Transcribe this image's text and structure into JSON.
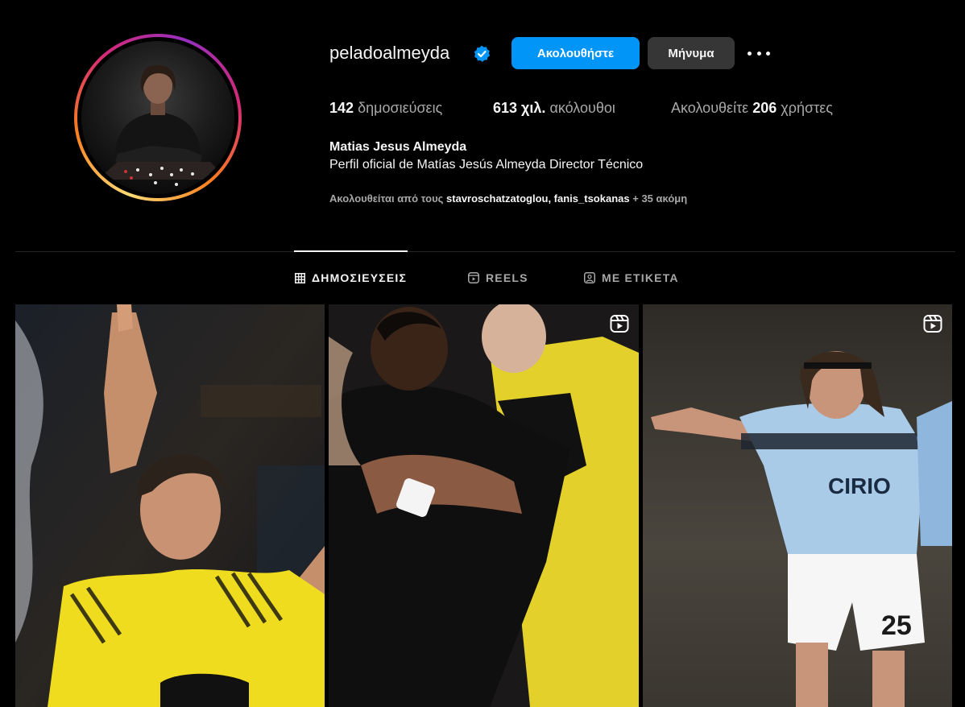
{
  "profile": {
    "username": "peladoalmeyda",
    "full_name": "Matias Jesus Almeyda",
    "bio": "Perfil oficial de Matías Jesús Almeyda Director Técnico",
    "verified_icon": "verified-badge-icon"
  },
  "actions": {
    "follow_label": "Ακολουθήστε",
    "message_label": "Μήνυμα",
    "more_icon": "more-options-icon"
  },
  "stats": {
    "posts_count": "142",
    "posts_label": "δημοσιεύσεις",
    "followers_count": "613 χιλ.",
    "followers_label": "ακόλουθοι",
    "following_prefix": "Ακολουθείτε",
    "following_count": "206",
    "following_suffix": "χρήστες"
  },
  "followed_by": {
    "prefix": "Ακολουθείται από τους",
    "accounts": "stavroschatzatoglou, fanis_tsokanas",
    "more": "+ 35 ακόμη"
  },
  "tabs": [
    {
      "label": "ΔΗΜΟΣΙΕΥΣΕΙΣ",
      "icon": "grid-icon",
      "active": true
    },
    {
      "label": "REELS",
      "icon": "reels-icon",
      "active": false
    },
    {
      "label": "ΜΕ ΕΤΙΚΕΤΑ",
      "icon": "tagged-icon",
      "active": false
    }
  ],
  "posts": [
    {
      "type": "image",
      "reel": false
    },
    {
      "type": "reel",
      "reel": true
    },
    {
      "type": "reel",
      "reel": true
    }
  ],
  "colors": {
    "background": "#000000",
    "primary_button": "#0095f6",
    "secondary_button": "#363636",
    "muted_text": "#a8a8a8"
  }
}
